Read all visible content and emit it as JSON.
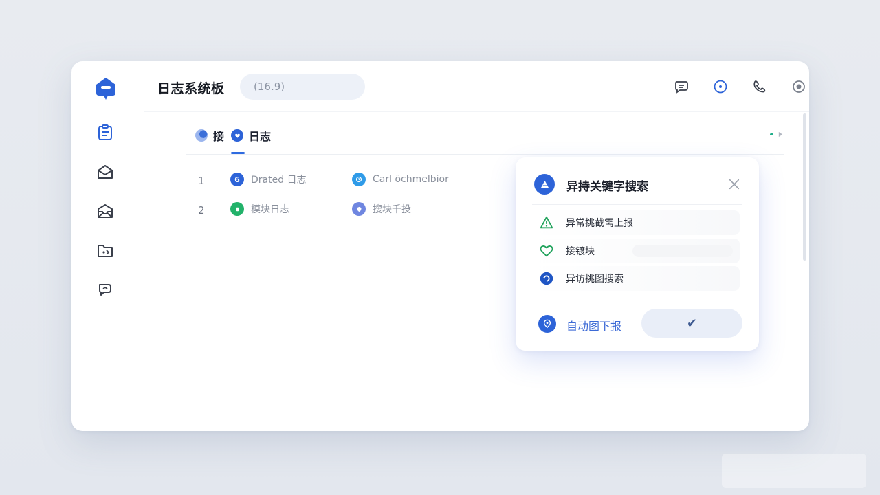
{
  "app": {
    "title": "日志系统板"
  },
  "search": {
    "value": "(16.9)"
  },
  "tabs": [
    {
      "label": "接"
    },
    {
      "label": "日志"
    }
  ],
  "rows": [
    {
      "num": "1",
      "col1": "Drated 日志",
      "col2": "Carl öchmelbior"
    },
    {
      "num": "2",
      "col1": "模块日志",
      "col2": "搜块千投"
    }
  ],
  "panel": {
    "title": "异持关键字搜索",
    "items": [
      {
        "label": "异常挑截需上报",
        "icon": "warning-triangle-icon"
      },
      {
        "label": "接镀块",
        "icon": "heart-icon"
      },
      {
        "label": "异访挑图搜索",
        "icon": "refresh-icon"
      }
    ],
    "footer_label": "自动图下报",
    "confirm_symbol": "✔"
  },
  "colors": {
    "accent": "#2f6be0",
    "green": "#22b26a",
    "panel_shadow": "#3c64dc"
  }
}
